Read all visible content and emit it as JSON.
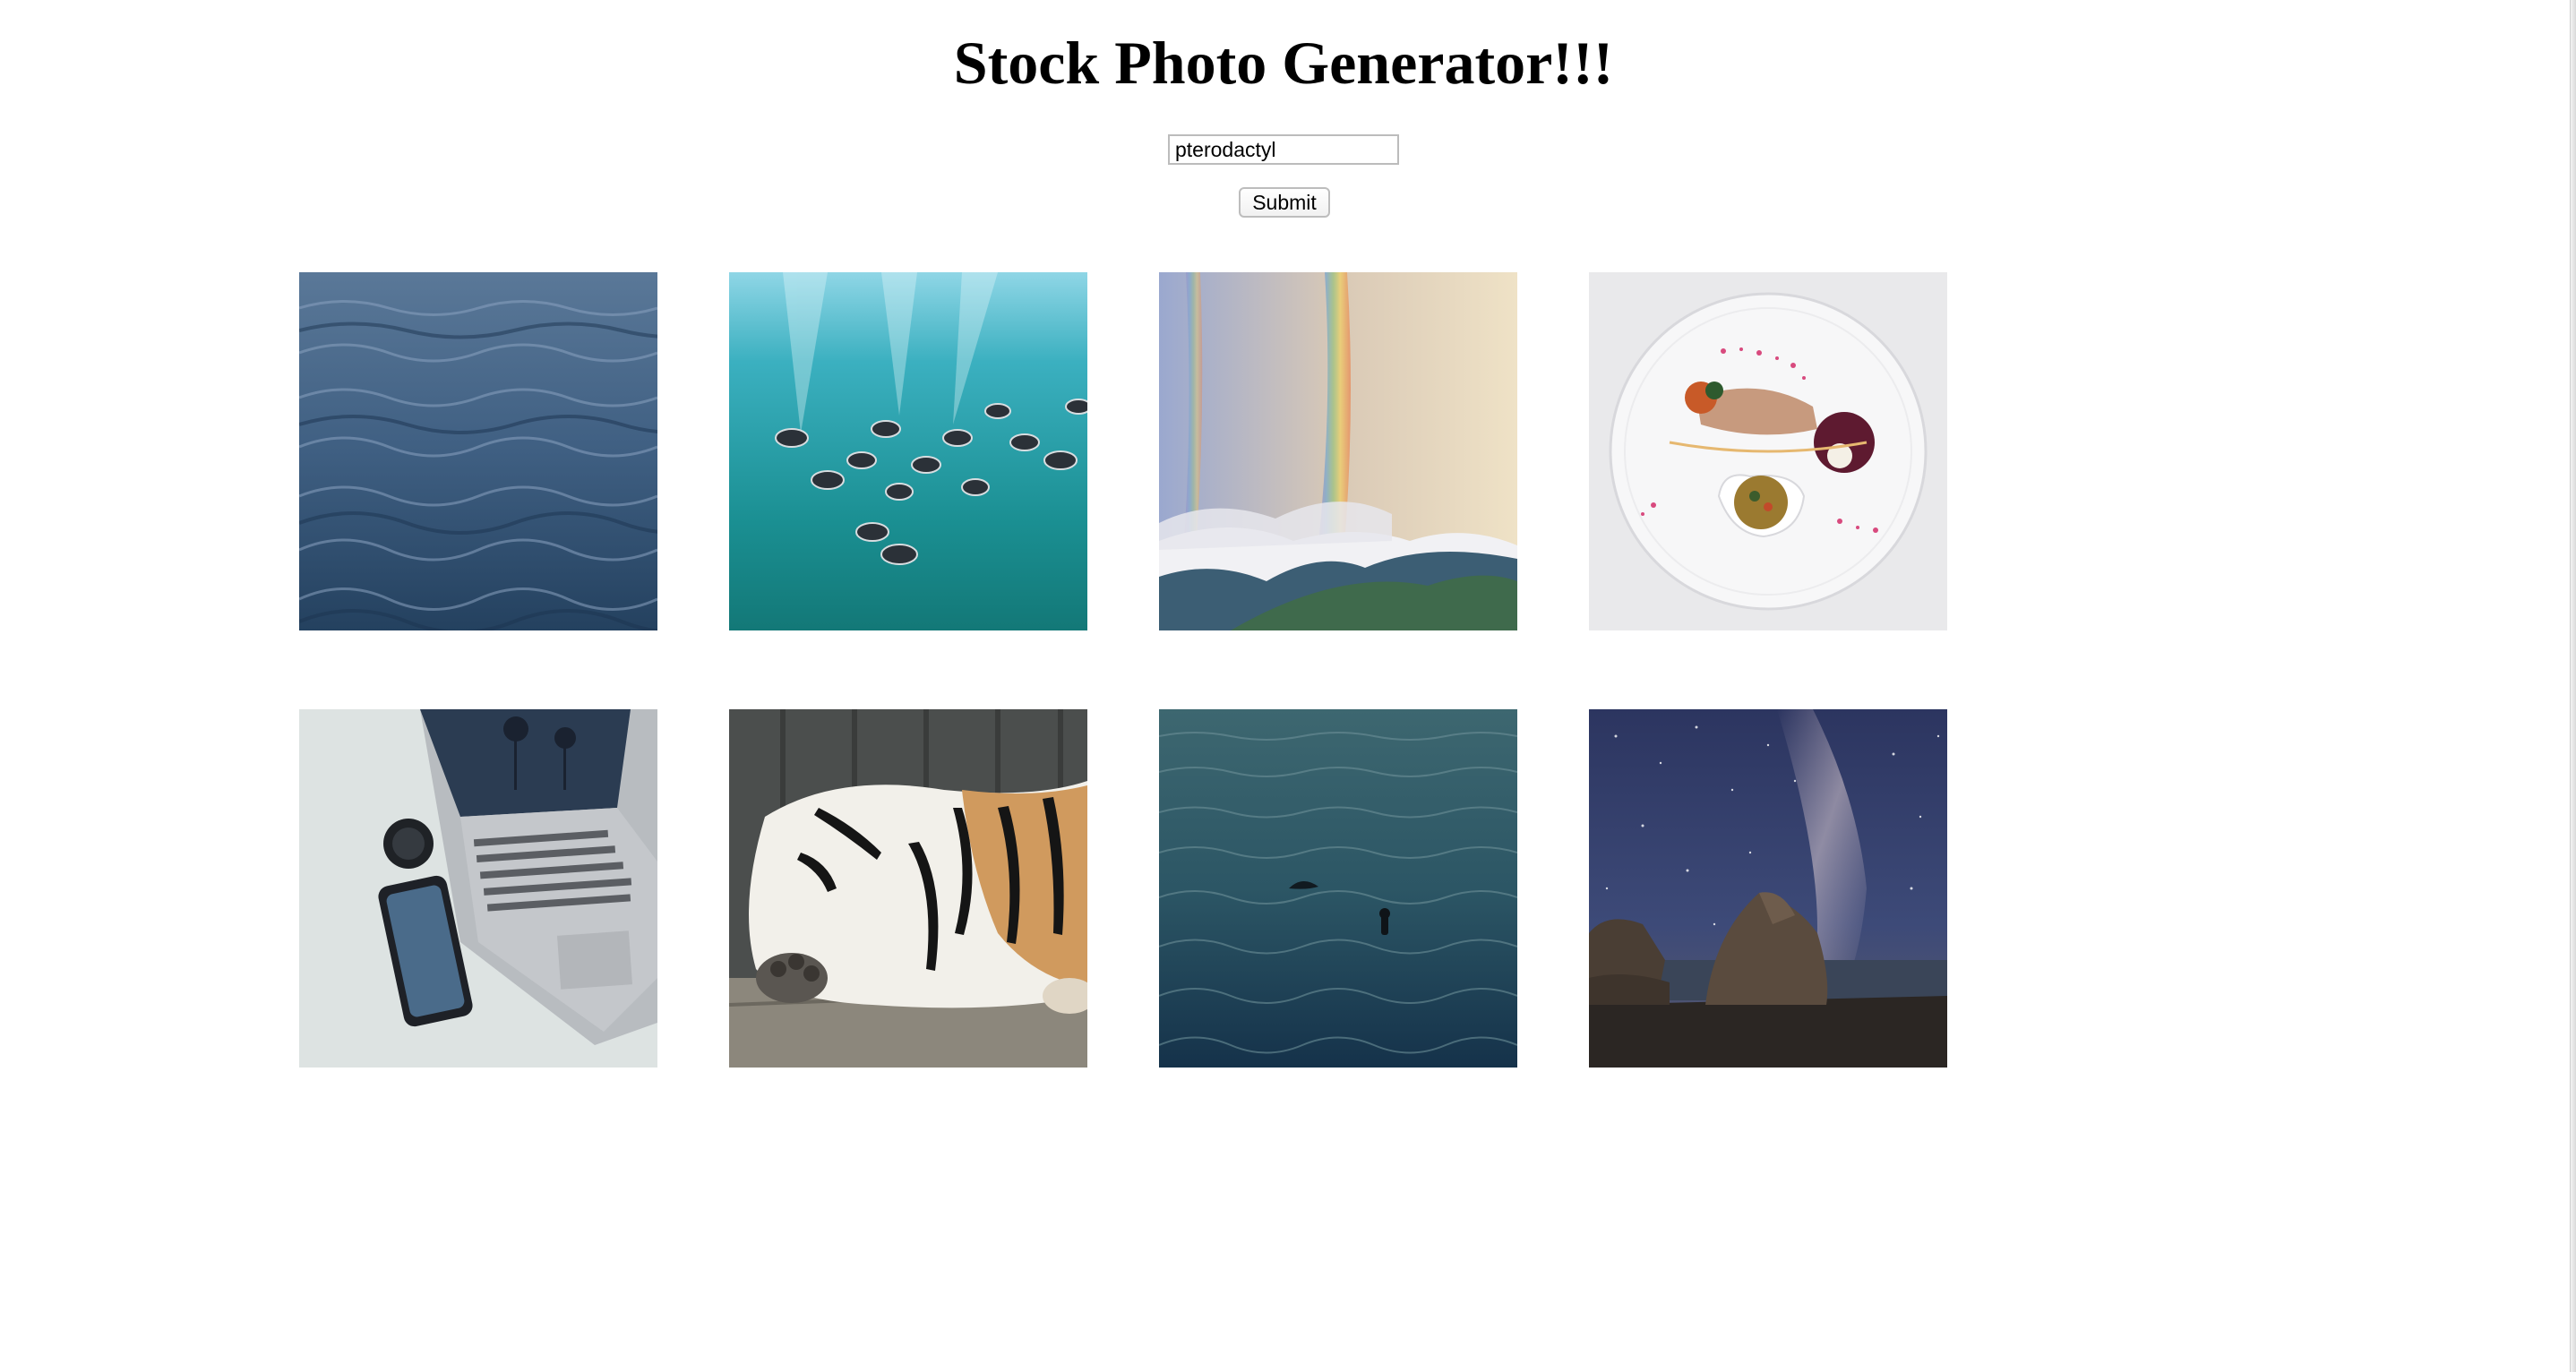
{
  "page": {
    "title": "Stock Photo Generator!!!"
  },
  "search": {
    "value": "pterodactyl"
  },
  "submit": {
    "label": "Submit"
  },
  "gallery": {
    "photos": [
      {
        "subject": "ocean-waves"
      },
      {
        "subject": "fish-underwater"
      },
      {
        "subject": "double-rainbow"
      },
      {
        "subject": "plated-dish"
      },
      {
        "subject": "laptop-phone-lens"
      },
      {
        "subject": "sleeping-tiger"
      },
      {
        "subject": "dolphin-swimmer-sea"
      },
      {
        "subject": "milky-way-coast"
      }
    ]
  }
}
